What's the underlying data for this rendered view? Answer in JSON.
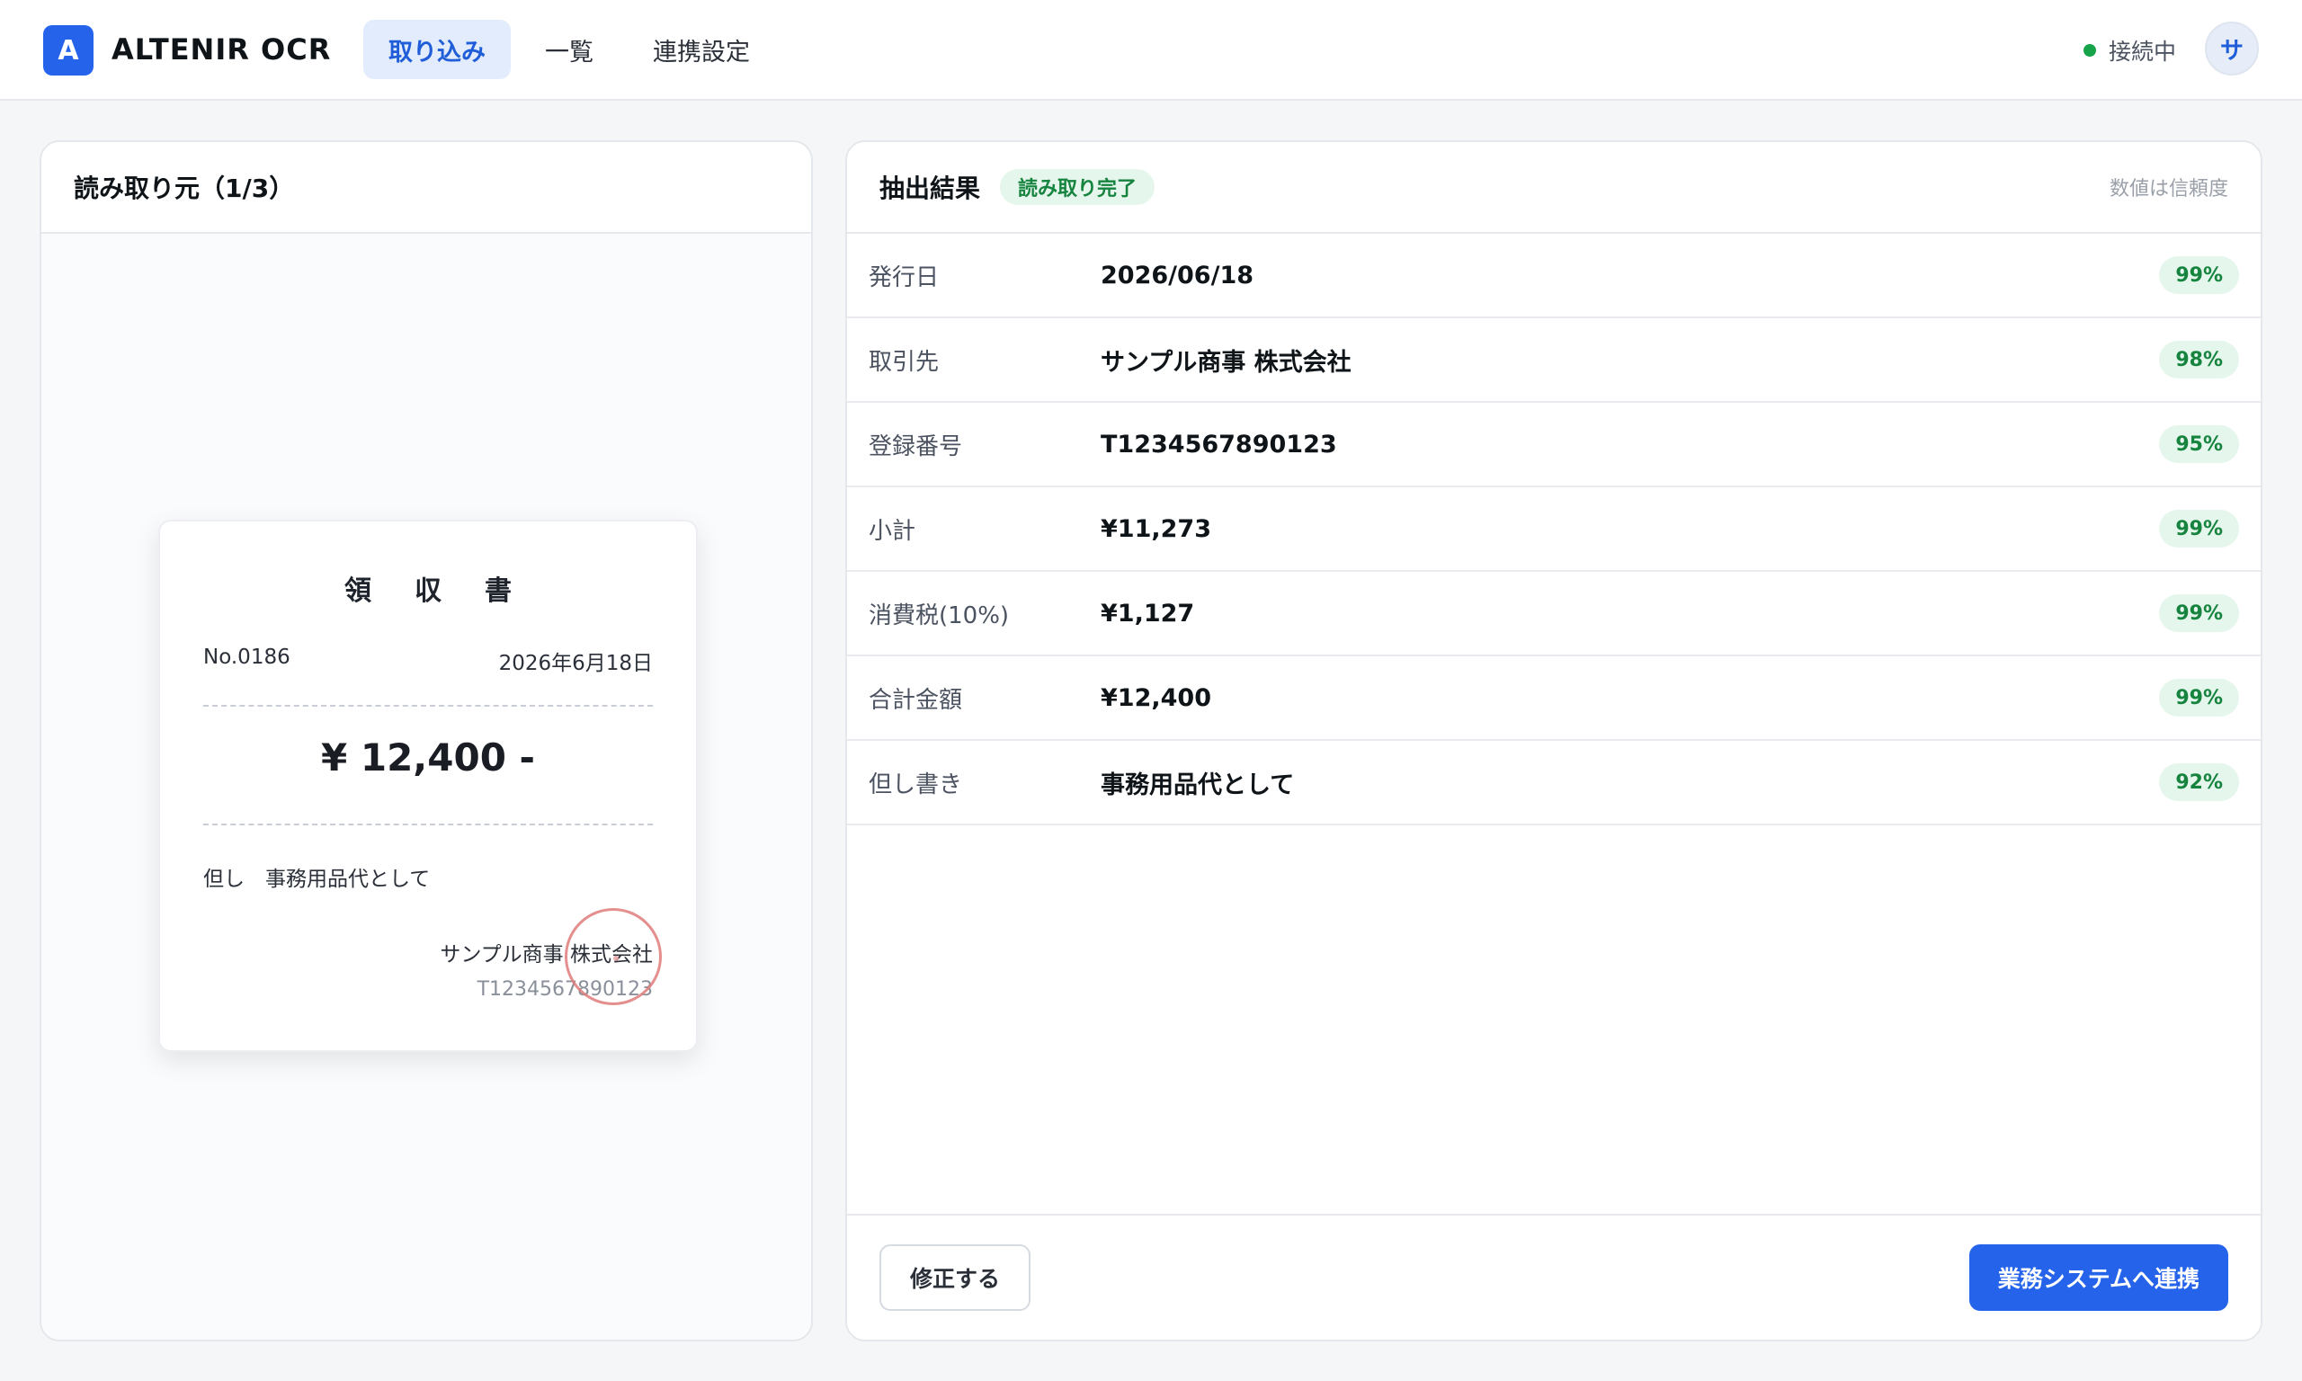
{
  "app": {
    "logo_letter": "A",
    "title": "ALTENIR OCR"
  },
  "nav": {
    "tabs": [
      {
        "label": "取り込み",
        "active": true
      },
      {
        "label": "一覧",
        "active": false
      },
      {
        "label": "連携設定",
        "active": false
      }
    ]
  },
  "header": {
    "status_text": "接続中",
    "status_color": "#16a34a",
    "avatar_initial": "サ"
  },
  "source": {
    "title": "読み取り元（1/3）",
    "receipt": {
      "title": "領収書",
      "number": "No.0186",
      "date": "2026年6月18日",
      "amount": "¥ 12,400 -",
      "memo": "但し　事務用品代として",
      "issuer": "サンプル商事 株式会社",
      "registration": "T1234567890123"
    }
  },
  "results": {
    "title": "抽出結果",
    "status_badge": "読み取り完了",
    "note": "数値は信頼度",
    "fields": [
      {
        "label": "発行日",
        "value": "2026/06/18",
        "confidence": "99%"
      },
      {
        "label": "取引先",
        "value": "サンプル商事 株式会社",
        "confidence": "98%"
      },
      {
        "label": "登録番号",
        "value": "T1234567890123",
        "confidence": "95%"
      },
      {
        "label": "小計",
        "value": "¥11,273",
        "confidence": "99%"
      },
      {
        "label": "消費税(10%)",
        "value": "¥1,127",
        "confidence": "99%"
      },
      {
        "label": "合計金額",
        "value": "¥12,400",
        "confidence": "99%"
      },
      {
        "label": "但し書き",
        "value": "事務用品代として",
        "confidence": "92%"
      }
    ],
    "edit_label": "修正する",
    "send_label": "業務システムへ連携"
  },
  "colors": {
    "accent": "#2563eb",
    "success": "#16a34a",
    "stamp": "#e07b7b"
  }
}
